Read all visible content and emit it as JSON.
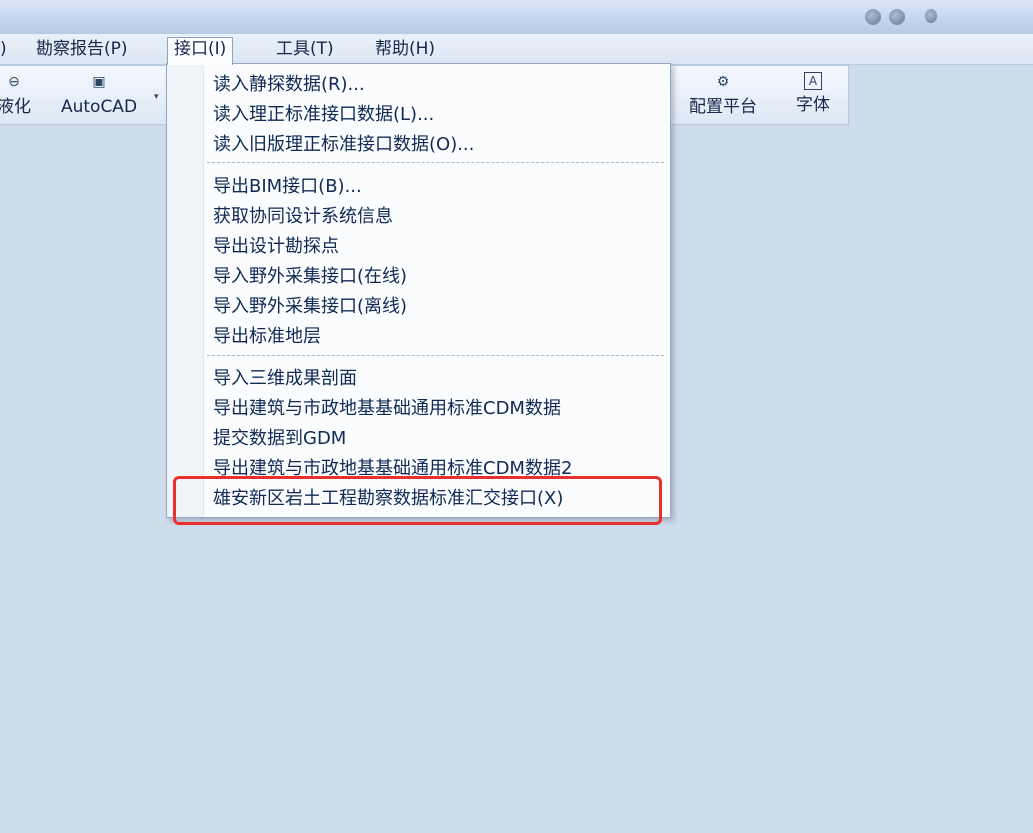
{
  "menubar": {
    "items": [
      {
        "label": ")"
      },
      {
        "label": "勘察报告(P)"
      },
      {
        "label": "接口(I)"
      },
      {
        "label": "工具(T)"
      },
      {
        "label": "帮助(H)"
      }
    ]
  },
  "ribbon": {
    "left": {
      "label": "液化"
    },
    "autocad": {
      "label": "AutoCAD"
    },
    "config": {
      "label": "配置平台"
    },
    "font": {
      "label": "字体",
      "glyph": "A"
    }
  },
  "dropdown": {
    "groups": [
      [
        "读入静探数据(R)...",
        "读入理正标准接口数据(L)...",
        "读入旧版理正标准接口数据(O)..."
      ],
      [
        "导出BIM接口(B)...",
        "获取协同设计系统信息",
        "导出设计勘探点",
        "导入野外采集接口(在线)",
        "导入野外采集接口(离线)",
        "导出标准地层"
      ],
      [
        "导入三维成果剖面",
        "导出建筑与市政地基基础通用标准CDM数据",
        "提交数据到GDM",
        "导出建筑与市政地基基础通用标准CDM数据2",
        "雄安新区岩土工程勘察数据标准汇交接口(X)"
      ]
    ]
  },
  "colors": {
    "highlight": "#e8312f",
    "background": "#cfdcec"
  }
}
